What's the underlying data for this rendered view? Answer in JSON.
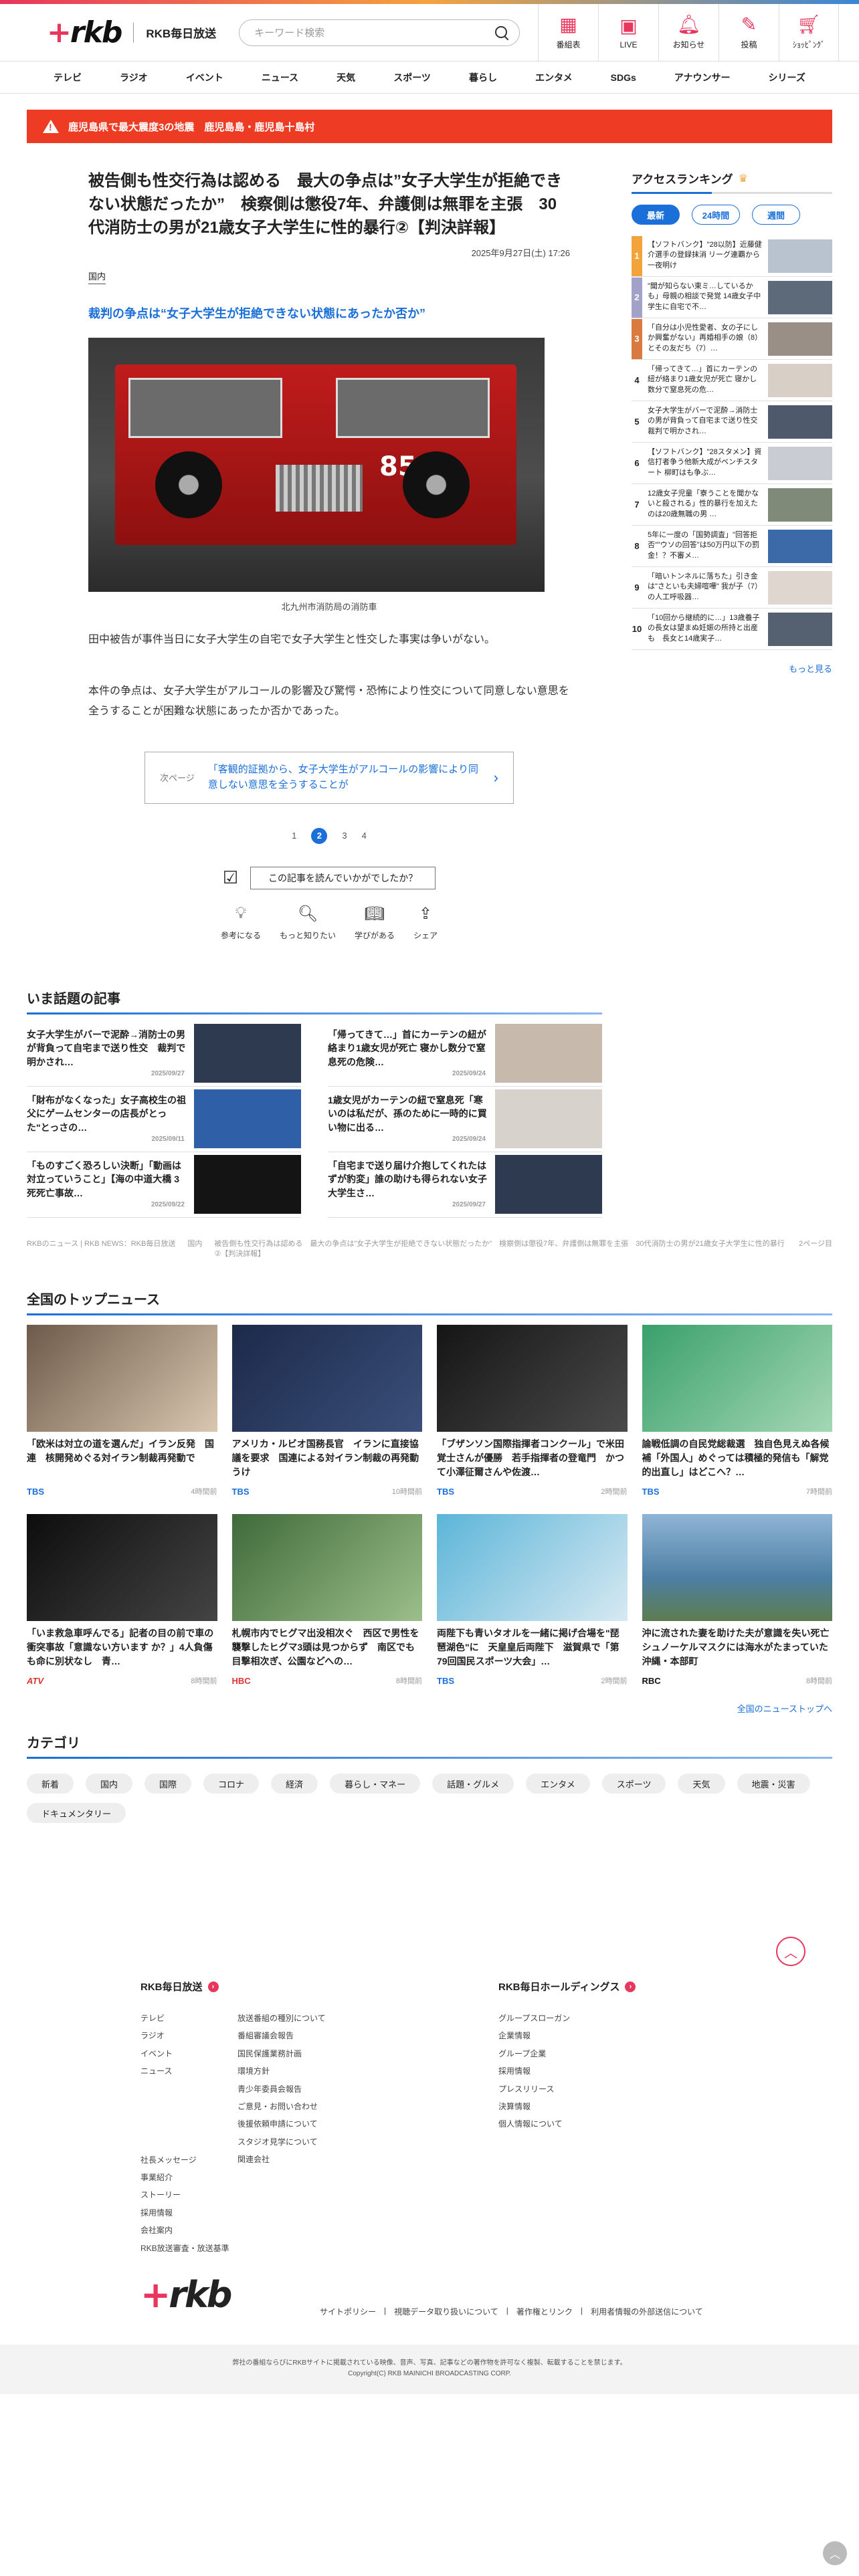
{
  "header": {
    "brand": "RKB毎日放送",
    "search_placeholder": "キーワード検索",
    "nav": [
      {
        "label": "番組表",
        "icon": "calendar-icon"
      },
      {
        "label": "LIVE",
        "icon": "live-icon"
      },
      {
        "label": "お知らせ",
        "icon": "bell-icon"
      },
      {
        "label": "投稿",
        "icon": "pencil-icon"
      },
      {
        "label": "ｼｮｯﾋﾟﾝｸﾞ",
        "icon": "cart-icon"
      }
    ]
  },
  "global_nav": [
    "テレビ",
    "ラジオ",
    "イベント",
    "ニュース",
    "天気",
    "スポーツ",
    "暮らし",
    "エンタメ",
    "SDGs",
    "アナウンサー",
    "シリーズ"
  ],
  "alert": {
    "text": "鹿児島県で最大震度3の地震　鹿児島島・鹿児島十島村"
  },
  "article": {
    "title": "被告側も性交行為は認める　最大の争点は”女子大学生が拒絶できない状態だったか”　検察側は懲役7年、弁護側は無罪を主張　30代消防士の男が21歳女子大学生に性的暴行②【判決詳報】",
    "date": "2025年9月27日(土) 17:26",
    "category": "国内",
    "subheading": "裁判の争点は“女子大学生が拒絶できない状態にあったか否か”",
    "photo_caption": "北九州市消防局の消防車",
    "paragraph1": "田中被告が事件当日に女子大学生の自宅で女子大学生と性交した事実は争いがない。",
    "paragraph2": "本件の争点は、女子大学生がアルコールの影響及び驚愕・恐怖により性交について同意しない意思を全うすることが困難な状態にあったか否かであった。",
    "next_label": "次ページ",
    "next_text": "「客観的証拠から、女子大学生がアルコールの影響により同意しない意思を全うすることが",
    "pages": [
      "1",
      "2",
      "3",
      "4"
    ],
    "current_page": "2",
    "feedback_q": "この記事を読んでいかがでしたか？",
    "reactions": [
      {
        "label": "参考になる",
        "icon": "lightbulb-icon"
      },
      {
        "label": "もっと知りたい",
        "icon": "magnifier-icon"
      },
      {
        "label": "学びがある",
        "icon": "book-icon"
      },
      {
        "label": "シェア",
        "icon": "share-icon"
      }
    ]
  },
  "ranking": {
    "title": "アクセスランキング",
    "tabs": [
      "最新",
      "24時間",
      "週間"
    ],
    "items": [
      {
        "rank": "1",
        "text": "【ソフトバンク】\"28以防】近藤健介選手の登録抹消 リーグ連覇から一夜明け"
      },
      {
        "rank": "2",
        "text": "\"聞が知らない東ミ…しているかも」母親の相談で発覚 14歳女子中学生に自宅で不…"
      },
      {
        "rank": "3",
        "text": "「自分は小児性愛者、女の子にしか興奮がない」再婚相手の娘（8）とその友だち（7）…"
      },
      {
        "rank": "4",
        "text": "「帰ってきて…」首にカーテンの紐が絡まり1歳女児が死亡 寝かし数分で窒息死の危…"
      },
      {
        "rank": "5",
        "text": "女子大学生がバーで泥酔→消防士の男が背負って自宅まで送り性交 裁判で明かされ…"
      },
      {
        "rank": "6",
        "text": "【ソフトバンク】\"28スタメン】資信打者争う他新大成がベンチスタート 柳町はも争ぶ…"
      },
      {
        "rank": "7",
        "text": "12歳女子児童「寮うことを聞かないと殺される」性的暴行を加えたのは20歳無職の男 …"
      },
      {
        "rank": "8",
        "text": "5年に一度の「国勢調査」\"回答拒否\"\"ウソの回答\"は50万円以下の罰金！？不審メ…"
      },
      {
        "rank": "9",
        "text": "「暗いトンネルに落ちた」引き金は\"さといも夫婦喧嘩\" 我が子（7）の人工呼吸器…"
      },
      {
        "rank": "10",
        "text": "「10回から継続的に…」13歳養子の長女は望まぬ妊娠の所持と出産も　長女と14歳実子…"
      }
    ],
    "more": "もっと見る"
  },
  "topics": {
    "title": "いま話題の記事",
    "items": [
      {
        "title": "女子大学生がバーで泥酔→消防士の男が背負って自宅まで送り性交　裁判で明かされ…",
        "date": "2025/09/27"
      },
      {
        "title": "「帰ってきて…」首にカーテンの紐が絡まり1歳女児が死亡 寝かし数分で窒息死の危険…",
        "date": "2025/09/24"
      },
      {
        "title": "「財布がなくなった」女子高校生の祖父にゲームセンターの店長がとった\"とっさの…",
        "date": "2025/09/11"
      },
      {
        "title": "1歳女児がカーテンの紐で窒息死「寒いのは私だが、孫のために一時的に買い物に出る…",
        "date": "2025/09/24"
      },
      {
        "title": "「ものすごく恐ろしい決断」「動画は対立っていうこと」【海の中道大橋 3死死亡事故…",
        "date": "2025/09/22"
      },
      {
        "title": "「自宅まで送り届け介抱してくれたはずが豹変」誰の助けも得られない女子大学生さ…",
        "date": "2025/09/27"
      }
    ]
  },
  "breadcrumb": [
    "RKBのニュース | RKB NEWS：RKB毎日放送",
    "国内",
    "被告側も性交行為は認める　最大の争点は\"女子大学生が拒絶できない状態だったか\"　検察側は懲役7年、弁護側は無罪を主張　30代消防士の男が21歳女子大学生に性的暴行②【判決詳報】",
    "2ページ目"
  ],
  "national": {
    "title": "全国のトップニュース",
    "items": [
      {
        "title": "「欧米は対立の道を選んだ」イラン反発　国連　核開発めぐる対イラン制裁再発動で",
        "source": "TBS",
        "time": "4時間前"
      },
      {
        "title": "アメリカ・ルビオ国務長官　イランに直接協議を要求　国連による対イラン制裁の再発動うけ",
        "source": "TBS",
        "time": "10時間前"
      },
      {
        "title": "「ブザンソン国際指揮者コンクール」で米田覚士さんが優勝　若手指揮者の登竜門　かつて小澤征爾さんや佐渡…",
        "source": "TBS",
        "time": "2時間前"
      },
      {
        "title": "論戦低調の自民党総裁選　独自色見えぬ各候補「外国人」めぐっては積極的発信も「解党的出直し」はどこへ？…",
        "source": "TBS",
        "time": "7時間前"
      },
      {
        "title": "「いま救急車呼んでる」記者の目の前で車の衝突事故「意識ない方います か？」4人負傷も命に別状なし　青…",
        "source": "ATV",
        "time": "8時間前"
      },
      {
        "title": "札幌市内でヒグマ出没相次ぐ　西区で男性を襲撃したヒグマ3頭は見つからず　南区でも目撃相次ぎ、公園などへの…",
        "source": "HBC",
        "time": "8時間前"
      },
      {
        "title": "両陛下も青いタオルを一緒に掲げ合場を\"琵琶湖色\"に　天皇皇后両陛下　滋賀県で「第79回国民スポーツ大会」…",
        "source": "TBS",
        "time": "2時間前"
      },
      {
        "title": "沖に流された妻を助けた夫が意識を失い死亡　シュノーケルマスクには海水がたまっていた　沖縄・本部町",
        "source": "RBC",
        "time": "8時間前"
      }
    ],
    "all_link": "全国のニューストップへ"
  },
  "categories": {
    "title": "カテゴリ",
    "items": [
      "新着",
      "国内",
      "国際",
      "コロナ",
      "経済",
      "暮らし・マネー",
      "話題・グルメ",
      "エンタメ",
      "スポーツ",
      "天気",
      "地震・災害",
      "ドキュメンタリー"
    ]
  },
  "footer": {
    "col1_title": "RKB毎日放送",
    "col1_left": [
      "テレビ",
      "ラジオ",
      "イベント",
      "ニュース",
      "",
      "",
      "",
      "",
      "社長メッセージ",
      "事業紹介",
      "ストーリー",
      "採用情報",
      "会社案内",
      "RKB放送審査・放送基準"
    ],
    "col1_right": [
      "放送番組の種別について",
      "番組審議会報告",
      "国民保護業務計画",
      "環境方針",
      "青少年委員会報告",
      "ご意見・お問い合わせ",
      "後援依頼申請について",
      "スタジオ見学について",
      "関連会社"
    ],
    "col2_title": "RKB毎日ホールディングス",
    "col2": [
      "グループスローガン",
      "企業情報",
      "グループ企業",
      "採用情報",
      "プレスリリース",
      "決算情報",
      "個人情報について"
    ],
    "links": [
      "サイトポリシー",
      "視聴データ取り扱いについて",
      "著作権とリンク",
      "利用者情報の外部送信について"
    ],
    "notice": "弊社の番組ならびにRKBサイトに掲載されている映像、音声、写真、記事などの著作物を許可なく複製、転載することを禁じます。",
    "copyright": "Copyright(C) RKB MAINICHI BROADCASTING CORP."
  }
}
